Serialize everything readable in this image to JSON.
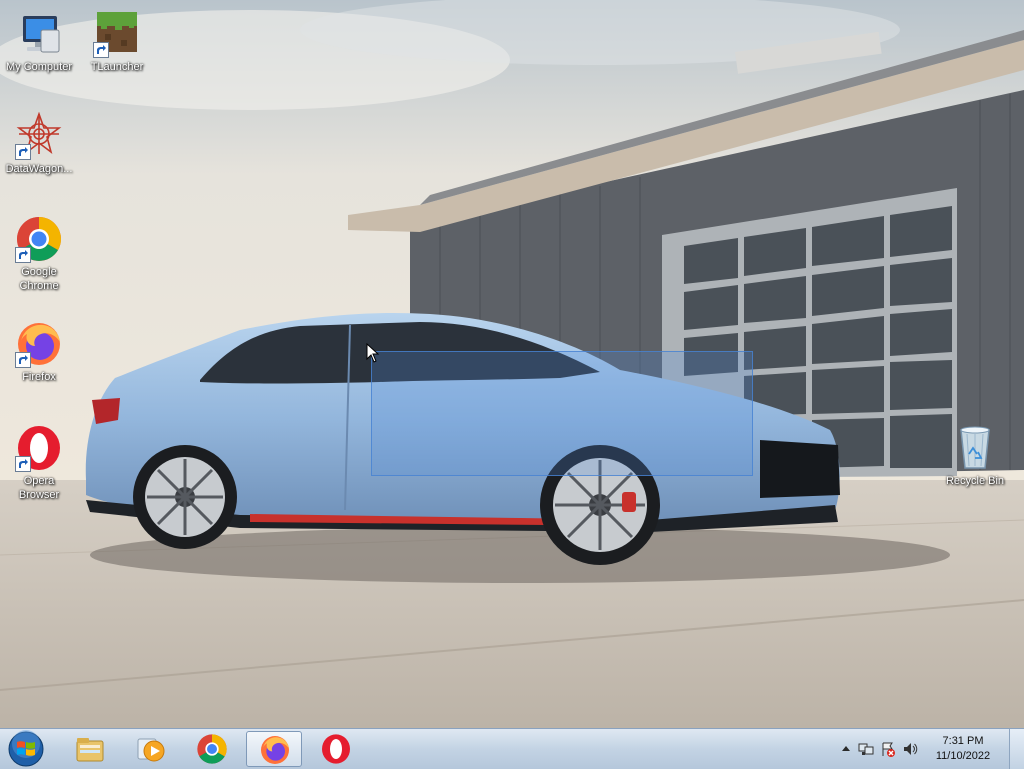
{
  "desktop": {
    "icons": [
      {
        "label": "My Computer",
        "icon": "computer-icon"
      },
      {
        "label": "TLauncher",
        "icon": "tlauncher-icon"
      },
      {
        "label": "DataWagon...",
        "icon": "datawagon-icon"
      },
      {
        "label": "Google Chrome",
        "icon": "chrome-icon"
      },
      {
        "label": "Firefox",
        "icon": "firefox-icon"
      },
      {
        "label": "Opera Browser",
        "icon": "opera-icon"
      },
      {
        "label": "Recycle Bin",
        "icon": "recycle-bin-icon"
      }
    ]
  },
  "taskbar": {
    "start": {
      "icon": "windows-start-icon"
    },
    "pinned": [
      {
        "icon": "file-explorer-icon",
        "active": false
      },
      {
        "icon": "media-player-icon",
        "active": false
      },
      {
        "icon": "chrome-icon",
        "active": false
      },
      {
        "icon": "firefox-icon",
        "active": true
      },
      {
        "icon": "opera-icon",
        "active": false
      }
    ],
    "tray": {
      "icons": [
        "show-hidden-icons-icon",
        "network-icon",
        "action-center-icon",
        "volume-icon"
      ],
      "time": "7:31 PM",
      "date": "11/10/2022"
    }
  },
  "colors": {
    "taskbar": "#c3d3e4",
    "selection": "#508cdc"
  }
}
